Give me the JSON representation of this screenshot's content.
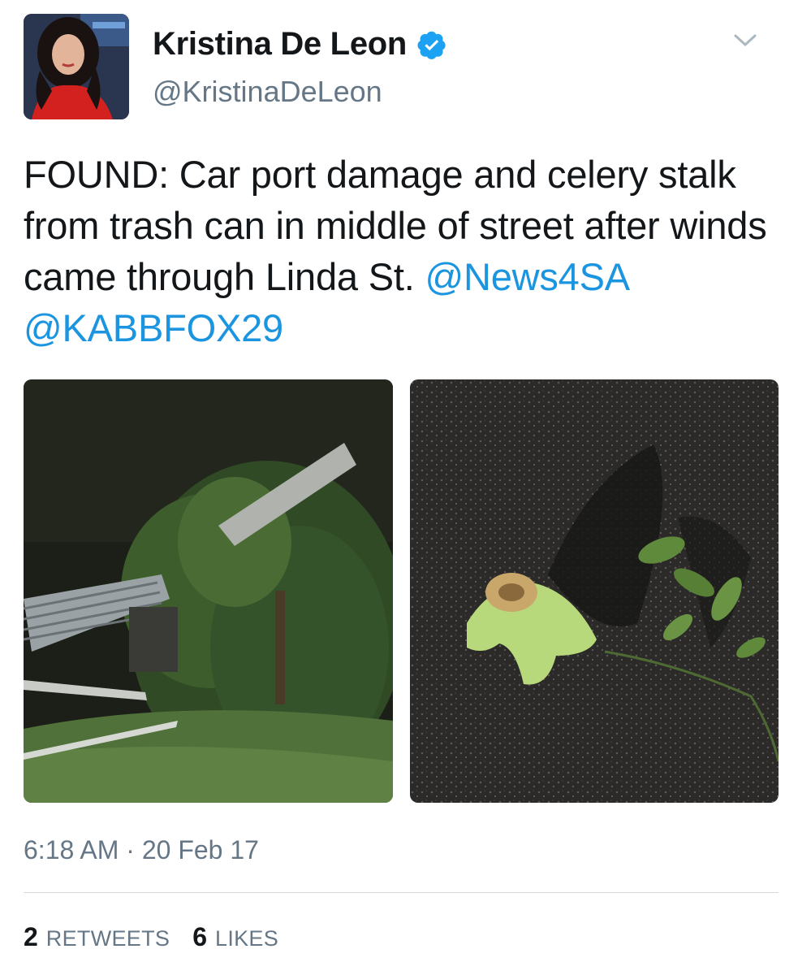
{
  "author": {
    "display_name": "Kristina De Leon",
    "handle": "@KristinaDeLeon",
    "verified": true,
    "avatar_icon": "profile-photo"
  },
  "tweet": {
    "text_part1": "FOUND: Car port damage and celery stalk from trash can in middle of street after winds came through Linda St. ",
    "mention1": "@News4SA",
    "mention2": "@KABBFOX29",
    "images": [
      {
        "description_icon": "photo-carport-damage"
      },
      {
        "description_icon": "photo-celery-stalk"
      }
    ],
    "timestamp": "6:18 AM · 20 Feb 17"
  },
  "stats": {
    "retweets_count": "2",
    "retweets_label": "RETWEETS",
    "likes_count": "6",
    "likes_label": "LIKES"
  },
  "colors": {
    "link": "#1b95e0",
    "secondary_text": "#657786",
    "verified": "#1da1f2"
  }
}
